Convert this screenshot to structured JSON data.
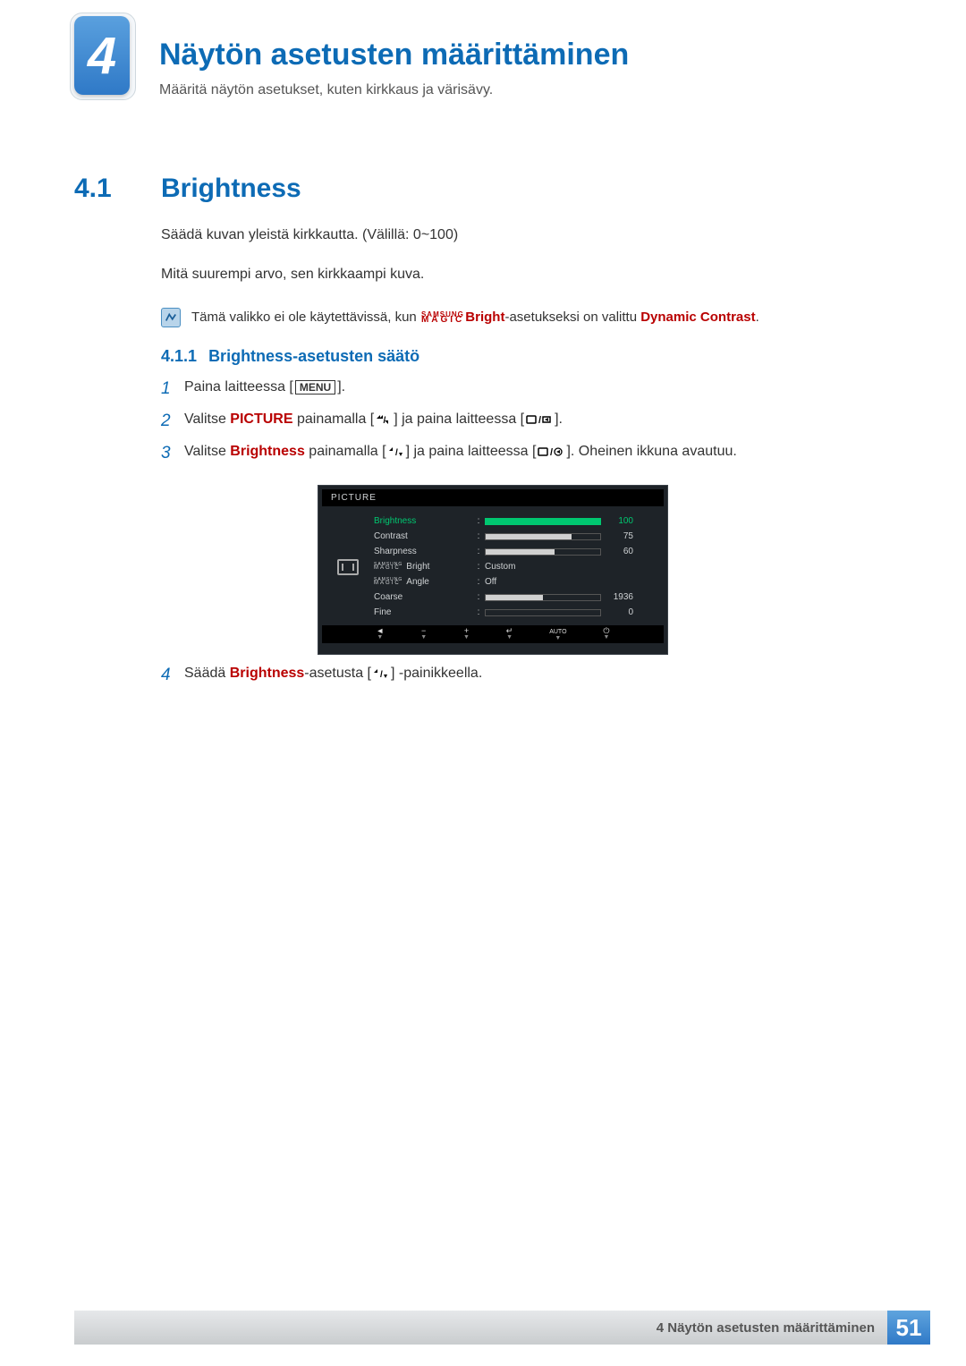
{
  "chapter": {
    "number": "4",
    "title": "Näytön asetusten määrittäminen",
    "description": "Määritä näytön asetukset, kuten kirkkaus ja värisävy."
  },
  "section": {
    "number": "4.1",
    "title": "Brightness",
    "body1": "Säädä kuvan yleistä kirkkautta. (Välillä: 0~100)",
    "body2": "Mitä suurempi arvo, sen kirkkaampi kuva."
  },
  "note": {
    "prefix": "Tämä valikko ei ole käytettävissä, kun ",
    "magic_top": "SAMSUNG",
    "magic_bottom": "MAGIC",
    "bright_word": "Bright",
    "middle": "-asetukseksi on valittu ",
    "dynamic": "Dynamic Contrast",
    "suffix": "."
  },
  "subsection": {
    "number": "4.1.1",
    "title": "Brightness-asetusten säätö"
  },
  "steps": {
    "s1_num": "1",
    "s1_text_a": "Paina laitteessa [",
    "s1_menu": "MENU",
    "s1_text_b": "].",
    "s2_num": "2",
    "s2_text_a": "Valitse ",
    "s2_picture": "PICTURE",
    "s2_text_b": " painamalla [",
    "s2_text_c": "] ja paina laitteessa [",
    "s2_text_d": "].",
    "s3_num": "3",
    "s3_text_a": "Valitse ",
    "s3_brightness": "Brightness",
    "s3_text_b": " painamalla [",
    "s3_text_c": "] ja paina laitteessa [",
    "s3_text_d": "]. Oheinen ikkuna avautuu.",
    "s4_num": "4",
    "s4_text_a": "Säädä ",
    "s4_brightness": "Brightness",
    "s4_text_b": "-asetusta [",
    "s4_text_c": "] -painikkeella."
  },
  "osd": {
    "header": "PICTURE",
    "rows": [
      {
        "label": "Brightness",
        "value": "100",
        "fill": 100,
        "selected": true,
        "type": "bar"
      },
      {
        "label": "Contrast",
        "value": "75",
        "fill": 75,
        "type": "bar"
      },
      {
        "label": "Sharpness",
        "value": "60",
        "fill": 60,
        "type": "bar"
      },
      {
        "label_magic": true,
        "label_suffix": "Bright",
        "textval": "Custom",
        "type": "text"
      },
      {
        "label_magic": true,
        "label_suffix": "Angle",
        "textval": "Off",
        "type": "text"
      },
      {
        "label": "Coarse",
        "value": "1936",
        "fill": 50,
        "type": "bar"
      },
      {
        "label": "Fine",
        "value": "0",
        "fill": 0,
        "type": "bar"
      }
    ],
    "footer": {
      "f1": "◄",
      "f2": "−",
      "f3": "+",
      "f4": "↵",
      "f5": "AUTO",
      "f6": "⏻"
    }
  },
  "footer": {
    "text": "4 Näytön asetusten määrittäminen",
    "page": "51"
  }
}
